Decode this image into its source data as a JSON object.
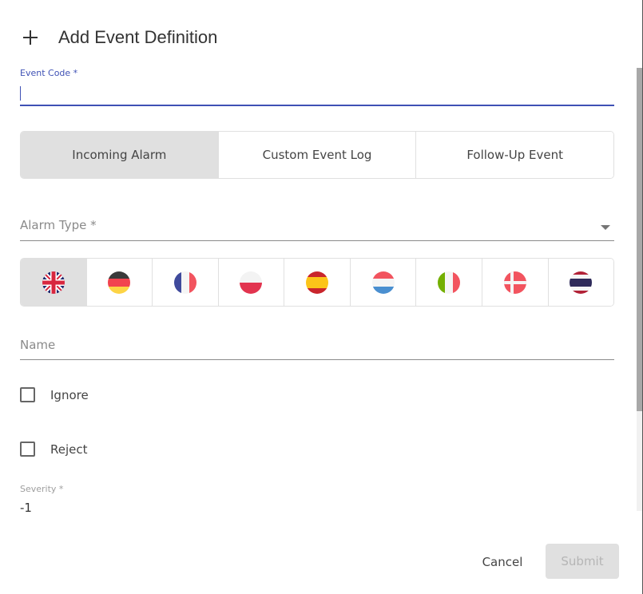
{
  "dialog": {
    "title": "Add Event Definition",
    "title_icon": "plus-icon"
  },
  "event_code": {
    "label": "Event Code *",
    "value": ""
  },
  "event_type_tabs": [
    {
      "label": "Incoming Alarm",
      "active": true
    },
    {
      "label": "Custom Event Log",
      "active": false
    },
    {
      "label": "Follow-Up Event",
      "active": false
    }
  ],
  "alarm_type": {
    "label": "Alarm Type *",
    "value": "",
    "icon": "chevron-down-icon"
  },
  "languages": [
    {
      "code": "en",
      "icon": "flag-uk-icon",
      "active": true
    },
    {
      "code": "de",
      "icon": "flag-germany-icon",
      "active": false
    },
    {
      "code": "fr",
      "icon": "flag-france-icon",
      "active": false
    },
    {
      "code": "pl",
      "icon": "flag-poland-icon",
      "active": false
    },
    {
      "code": "es",
      "icon": "flag-spain-icon",
      "active": false
    },
    {
      "code": "lu",
      "icon": "flag-luxembourg-icon",
      "active": false
    },
    {
      "code": "it",
      "icon": "flag-italy-icon",
      "active": false
    },
    {
      "code": "dk",
      "icon": "flag-denmark-icon",
      "active": false
    },
    {
      "code": "th",
      "icon": "flag-thailand-icon",
      "active": false
    }
  ],
  "name": {
    "label": "Name",
    "value": ""
  },
  "checkboxes": [
    {
      "label": "Ignore",
      "checked": false
    },
    {
      "label": "Reject",
      "checked": false
    }
  ],
  "severity": {
    "label": "Severity *",
    "value": "-1"
  },
  "actions": {
    "cancel_label": "Cancel",
    "submit_label": "Submit",
    "submit_disabled": true
  },
  "colors": {
    "accent": "#3f51b5",
    "active_segment": "#e0e0e0",
    "disabled_button": "#e0e0e0"
  }
}
